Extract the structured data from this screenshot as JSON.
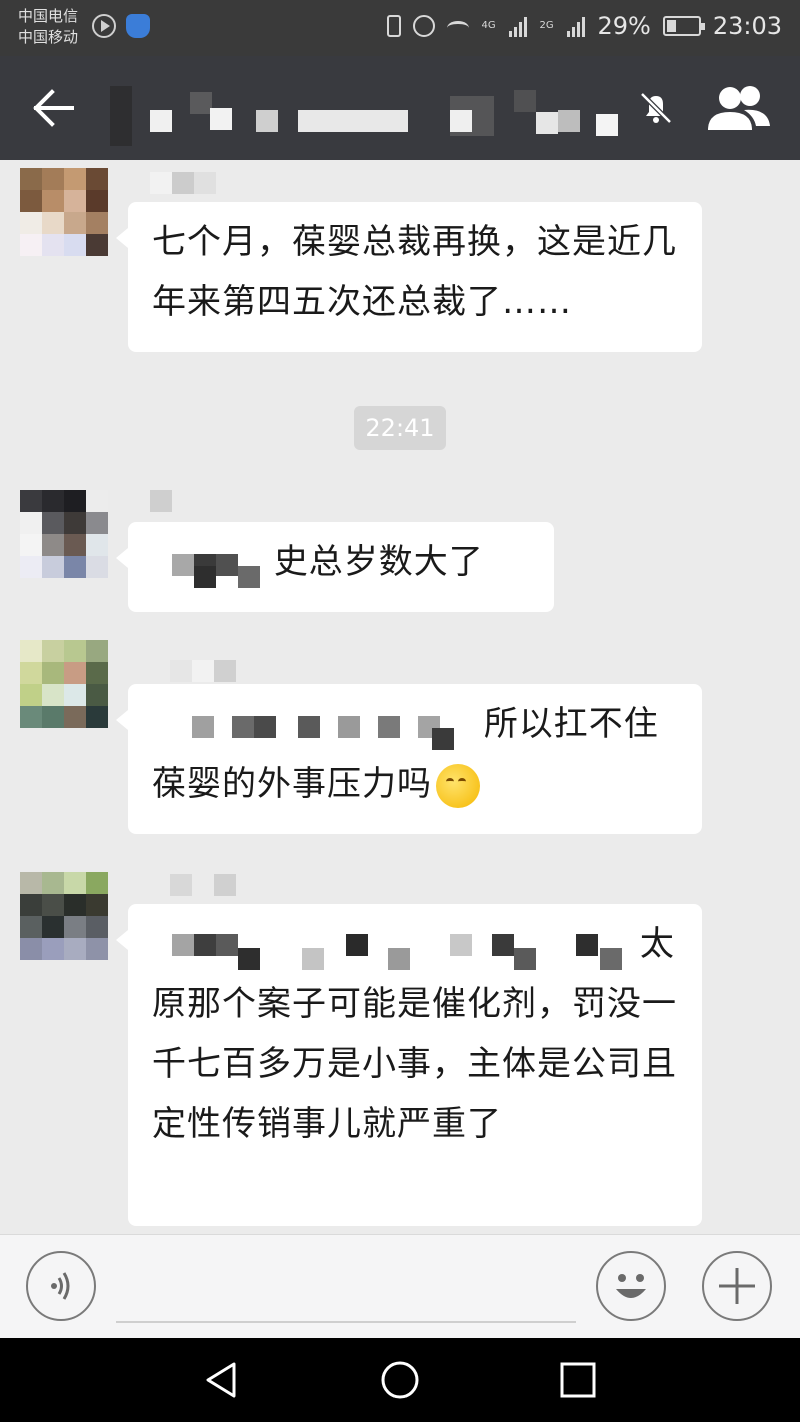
{
  "status_bar": {
    "carrier_1": "中国电信",
    "carrier_2": "中国移动",
    "network_1": "4G",
    "network_2": "2G",
    "battery_text": "29%",
    "battery_level": 0.29,
    "time": "23:03"
  },
  "title_bar": {
    "back_icon": "arrow-left-icon",
    "mute_icon": "bell-off-icon",
    "members_icon": "group-icon"
  },
  "messages": [
    {
      "type": "incoming",
      "text": "七个月，葆婴总裁再换，这是近几年来第四五次还总裁了……"
    },
    {
      "type": "time",
      "text": "22:41"
    },
    {
      "type": "incoming",
      "text": "史总岁数大了"
    },
    {
      "type": "incoming",
      "text": "所以扛不住葆婴的外事压力吗",
      "emoji": "thinking-face-icon"
    },
    {
      "type": "incoming",
      "text": "太原那个案子可能是催化剂，罚没一千七百多万是小事，主体是公司且定性传销事儿就严重了"
    }
  ],
  "input_bar": {
    "voice_icon": "voice-icon",
    "emoji_icon": "smiley-icon",
    "plus_icon": "plus-icon",
    "placeholder": ""
  },
  "nav_bar": {
    "back_icon": "triangle-back-icon",
    "home_icon": "circle-home-icon",
    "recents_icon": "square-recents-icon"
  },
  "colors": {
    "header_bg": "#393a3f",
    "chat_bg": "#ebebeb",
    "bubble_bg": "#ffffff",
    "time_chip_bg": "#d6d6d6"
  }
}
